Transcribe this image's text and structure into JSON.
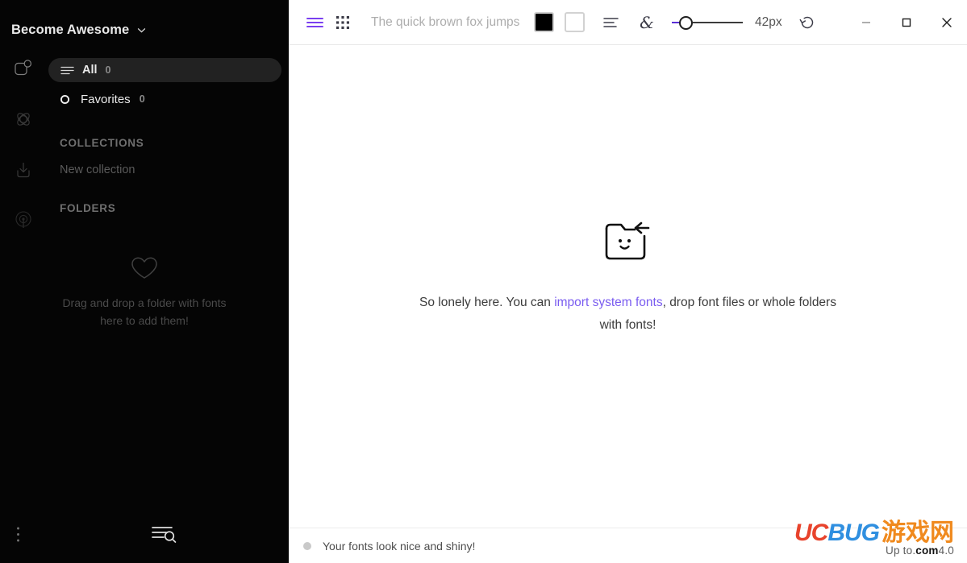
{
  "sidebar": {
    "profile": {
      "name": "Become Awesome",
      "chevron_icon": "chevron-down-icon"
    },
    "rail": [
      {
        "icon": "fonts-badge-icon",
        "name": "fonts"
      },
      {
        "icon": "atom-icon",
        "name": "activate"
      },
      {
        "icon": "download-icon",
        "name": "install"
      },
      {
        "icon": "broadcast-icon",
        "name": "sync"
      }
    ],
    "nav": [
      {
        "icon": "lines-icon",
        "label": "All",
        "count": "0",
        "active": true
      },
      {
        "icon": "circle-icon",
        "label": "Favorites",
        "count": "0",
        "active": false
      }
    ],
    "collections": {
      "title": "COLLECTIONS",
      "new_item": "New collection"
    },
    "folders": {
      "title": "FOLDERS",
      "empty_icon": "heart-icon",
      "empty_text": "Drag and drop a folder with fonts here to add them!"
    },
    "bottom": [
      {
        "icon": "kebab-menu-icon",
        "name": "more-options"
      },
      {
        "icon": "list-search-icon",
        "name": "list-search"
      }
    ]
  },
  "toolbar": {
    "view_list_icon": "list-view-icon",
    "view_grid_icon": "grid-view-icon",
    "preview_value": "",
    "preview_placeholder": "The quick brown fox jumps",
    "foreground_color": "#000000",
    "background_color": "#ffffff",
    "align_icon": "text-align-left-icon",
    "ampersand_icon": "ampersand-icon",
    "size_value": "42px",
    "size_slider_percent": 12,
    "reset_icon": "reset-icon",
    "accent_color": "#7a5cf0"
  },
  "window_controls": {
    "minimize": "minimize-icon",
    "maximize": "maximize-icon",
    "close": "close-icon"
  },
  "content": {
    "empty_icon": "folder-smiley-arrow-icon",
    "text_before": "So lonely here. You can ",
    "link": "import system fonts",
    "text_after": ", drop font files or whole folders with fonts!"
  },
  "statusbar": {
    "dot_color": "#c9c9c9",
    "message": "Your fonts look nice and shiny!"
  },
  "watermark": {
    "uc": "UC",
    "bug": "BUG",
    "cn": "游戏网",
    "sub_pre": "Up to.",
    "sub_com": "com",
    "sub_post": "4.0"
  }
}
